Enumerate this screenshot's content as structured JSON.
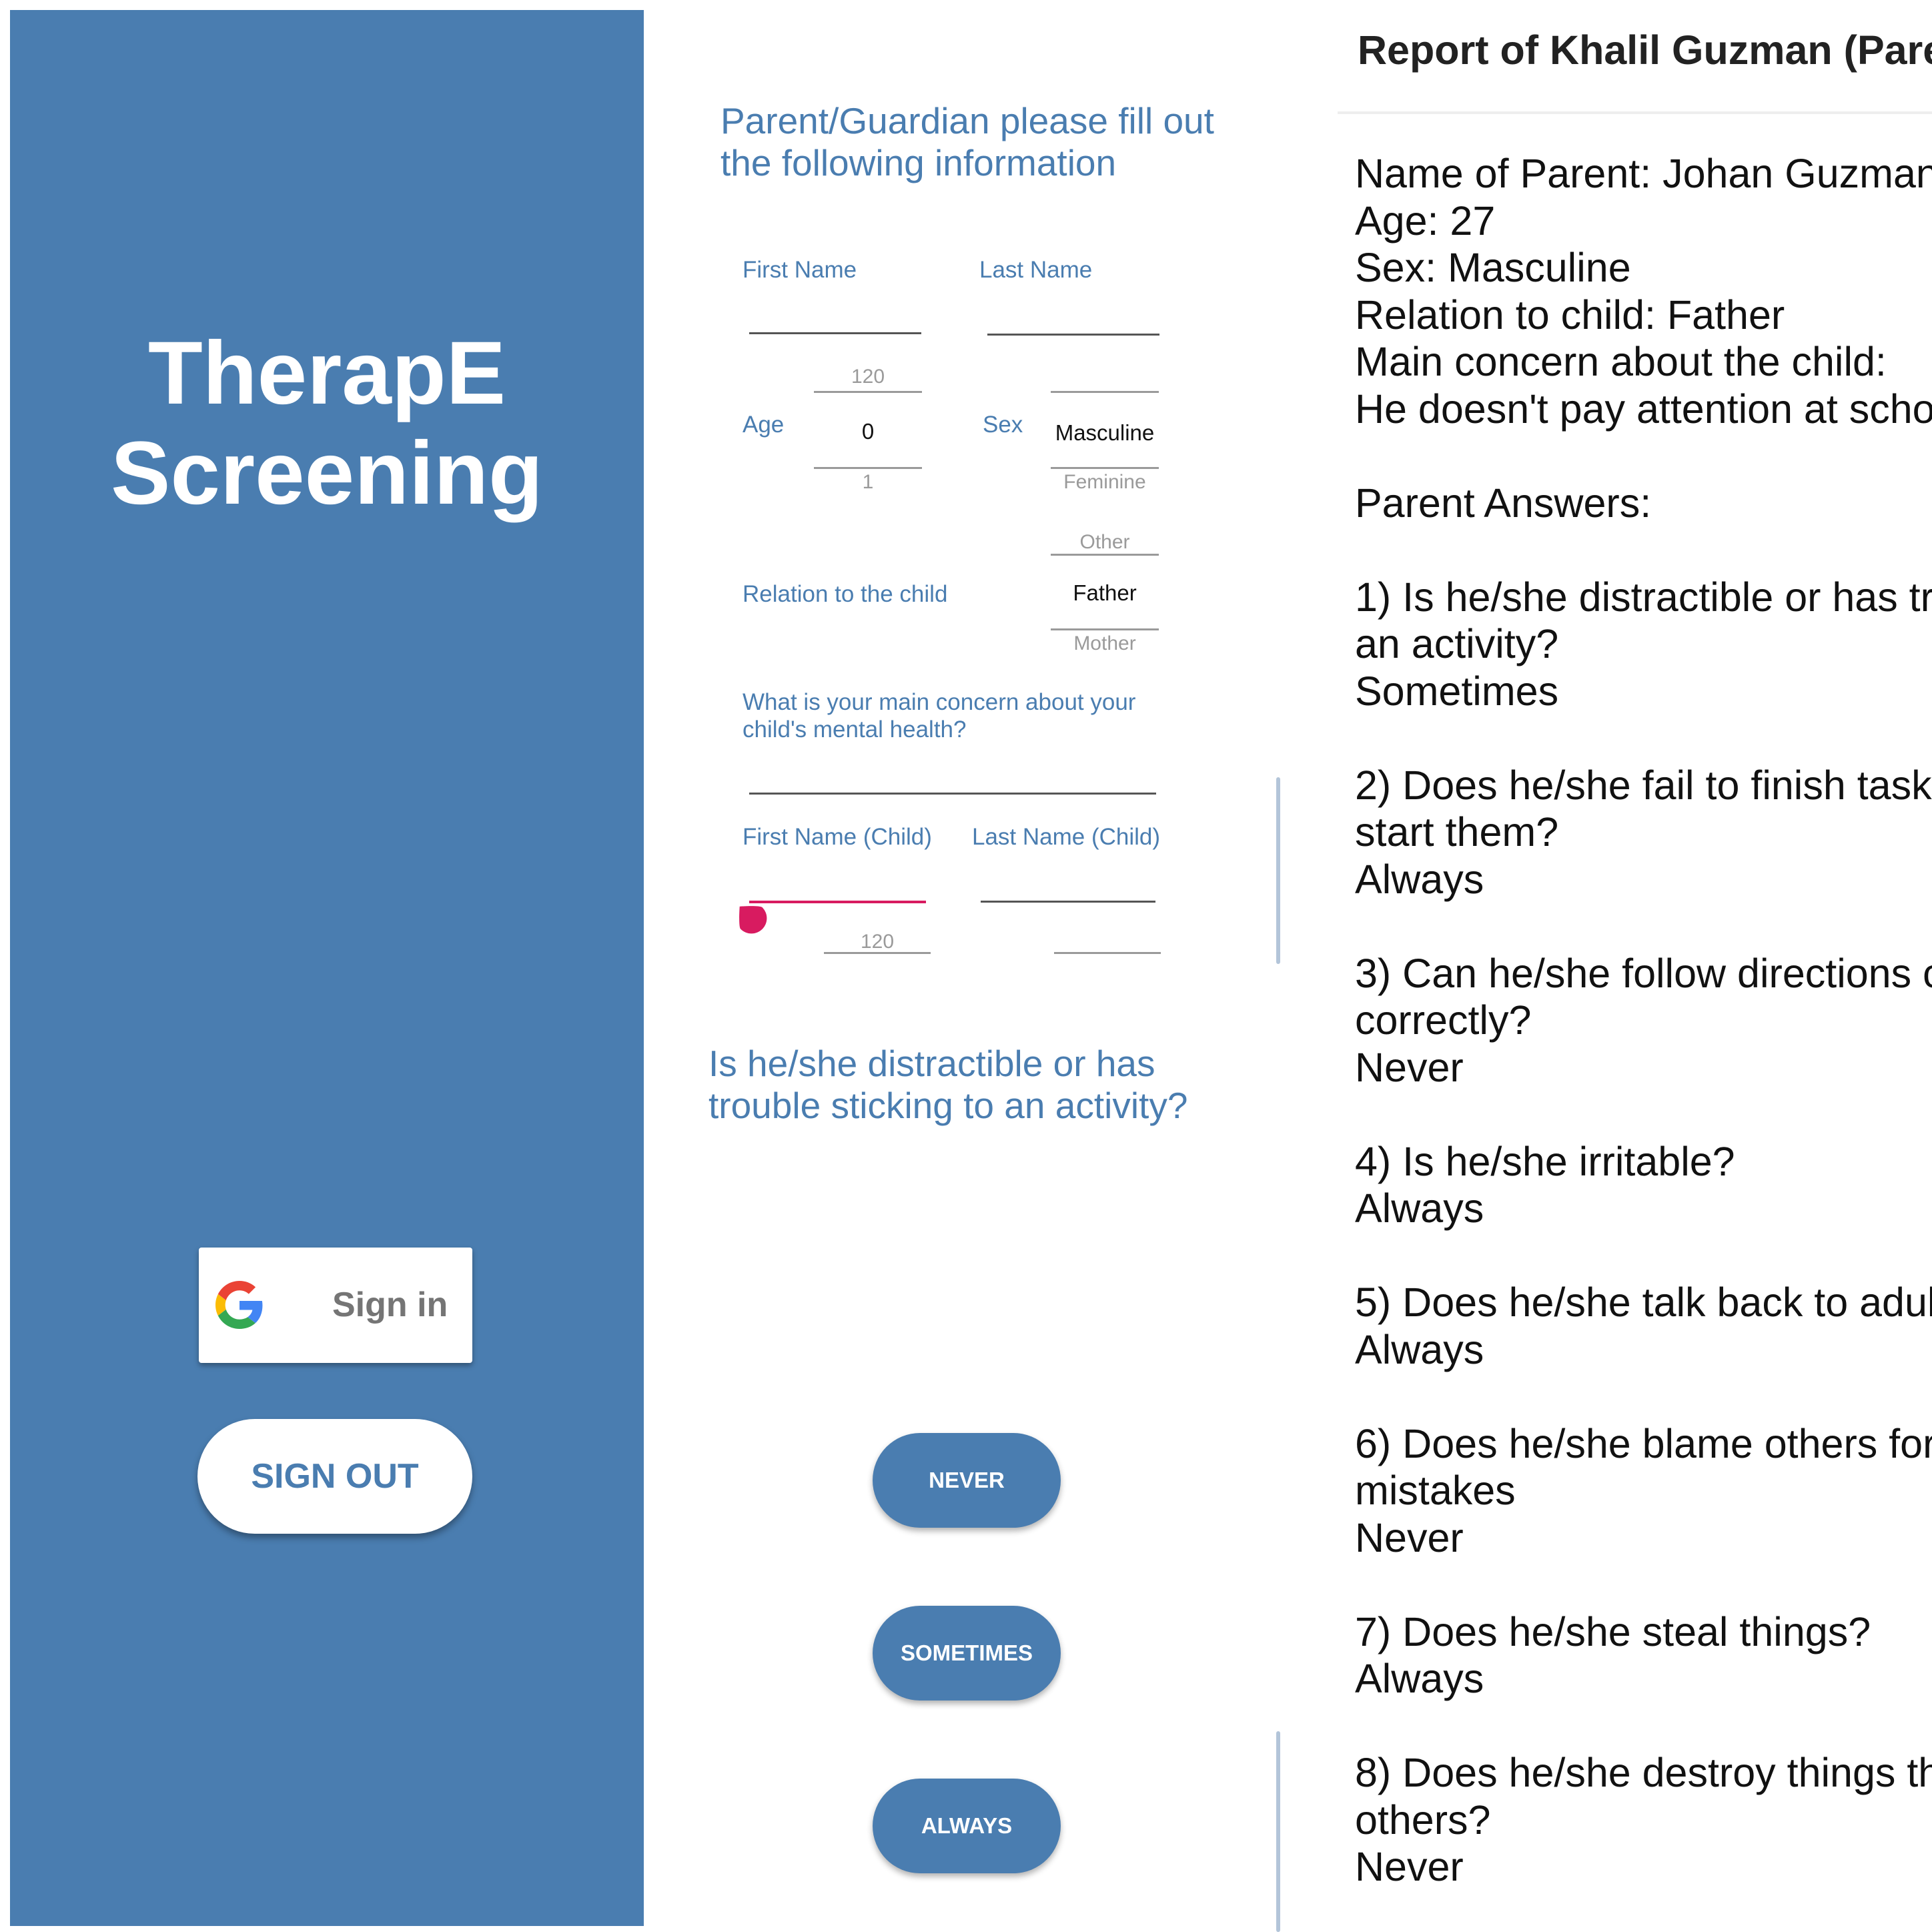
{
  "splash": {
    "title_line1": "TherapE",
    "title_line2": "Screening",
    "google_signin_label": "Sign in",
    "signout_label": "SIGN OUT",
    "background_color": "#4a7db0"
  },
  "form": {
    "title_line1": "Parent/Guardian please fill out",
    "title_line2": "the following information",
    "first_name_label": "First Name",
    "last_name_label": "Last Name",
    "age_label": "Age",
    "age_picker": {
      "above": "120",
      "selected": "0",
      "below": "1"
    },
    "sex_label": "Sex",
    "sex_picker": {
      "selected": "Masculine",
      "options_below": [
        "Feminine",
        "Other"
      ]
    },
    "relation_label": "Relation to the child",
    "relation_picker": {
      "selected": "Father",
      "below": "Mother"
    },
    "concern_label_line1": "What is your main concern about your",
    "concern_label_line2": "child's mental health?",
    "child_first_name_label": "First Name (Child)",
    "child_last_name_label": "Last Name (Child)",
    "child_age_hint": "120",
    "accent_color": "#d81b60"
  },
  "question": {
    "text_line1": "Is he/she distractible or has",
    "text_line2": "trouble sticking to an activity?",
    "answers": [
      "NEVER",
      "SOMETIMES",
      "ALWAYS"
    ]
  },
  "report": {
    "title": "Report of Khalil Guzman (Parent",
    "lines": [
      "Name of Parent: Johan Guzman",
      "Age: 27",
      "Sex: Masculine",
      "Relation to child: Father",
      "Main concern about the child:",
      "He doesn't pay attention at scho",
      "",
      "Parent Answers:",
      "",
      "1) Is he/she distractible or has tr",
      "an activity?",
      "Sometimes",
      "",
      "2) Does he/she fail to finish task",
      "start them?",
      "Always",
      "",
      "3) Can he/she follow directions c",
      "correctly?",
      "Never",
      "",
      "4) Is he/she irritable?",
      "Always",
      "",
      "5) Does he/she talk back to adul",
      "Always",
      "",
      "6) Does he/she blame others for",
      "mistakes",
      "Never",
      "",
      "7) Does he/she steal things?",
      "Always",
      "",
      "8) Does he/she destroy things th",
      "others?",
      "Never"
    ]
  }
}
